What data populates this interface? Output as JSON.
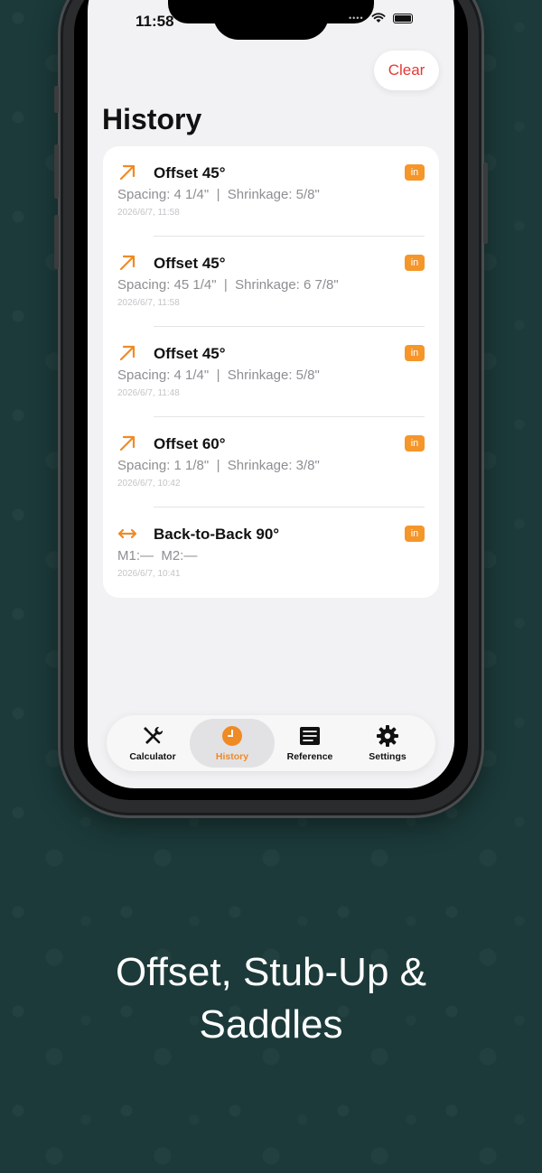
{
  "status_bar": {
    "time": "11:58"
  },
  "header": {
    "title": "History",
    "clear_label": "Clear"
  },
  "history": [
    {
      "icon": "arrow-up-right-icon",
      "title": "Offset 45°",
      "badge": "in",
      "detail": "Spacing: 4 1/4\"  |  Shrinkage: 5/8\"",
      "timestamp": "2026/6/7, 11:58"
    },
    {
      "icon": "arrow-up-right-icon",
      "title": "Offset 45°",
      "badge": "in",
      "detail": "Spacing: 45 1/4\"  |  Shrinkage: 6 7/8\"",
      "timestamp": "2026/6/7, 11:58"
    },
    {
      "icon": "arrow-up-right-icon",
      "title": "Offset 45°",
      "badge": "in",
      "detail": "Spacing: 4 1/4\"  |  Shrinkage: 5/8\"",
      "timestamp": "2026/6/7, 11:48"
    },
    {
      "icon": "arrow-up-right-icon",
      "title": "Offset 60°",
      "badge": "in",
      "detail": "Spacing: 1 1/8\"  |  Shrinkage: 3/8\"",
      "timestamp": "2026/6/7, 10:42"
    },
    {
      "icon": "left-right-arrow-icon",
      "title": "Back-to-Back 90°",
      "badge": "in",
      "detail": "M1:—  M2:—",
      "timestamp": "2026/6/7, 10:41"
    }
  ],
  "tabs": [
    {
      "label": "Calculator",
      "icon": "wrench-screwdriver-icon",
      "active": false
    },
    {
      "label": "History",
      "icon": "clock-icon",
      "active": true
    },
    {
      "label": "Reference",
      "icon": "list-icon",
      "active": false
    },
    {
      "label": "Settings",
      "icon": "gear-icon",
      "active": false
    }
  ],
  "caption": {
    "line1": "Offset, Stub-Up &",
    "line2": "Saddles"
  },
  "colors": {
    "accent": "#f08a24",
    "destructive": "#e53935",
    "background": "#1c3a3a"
  }
}
